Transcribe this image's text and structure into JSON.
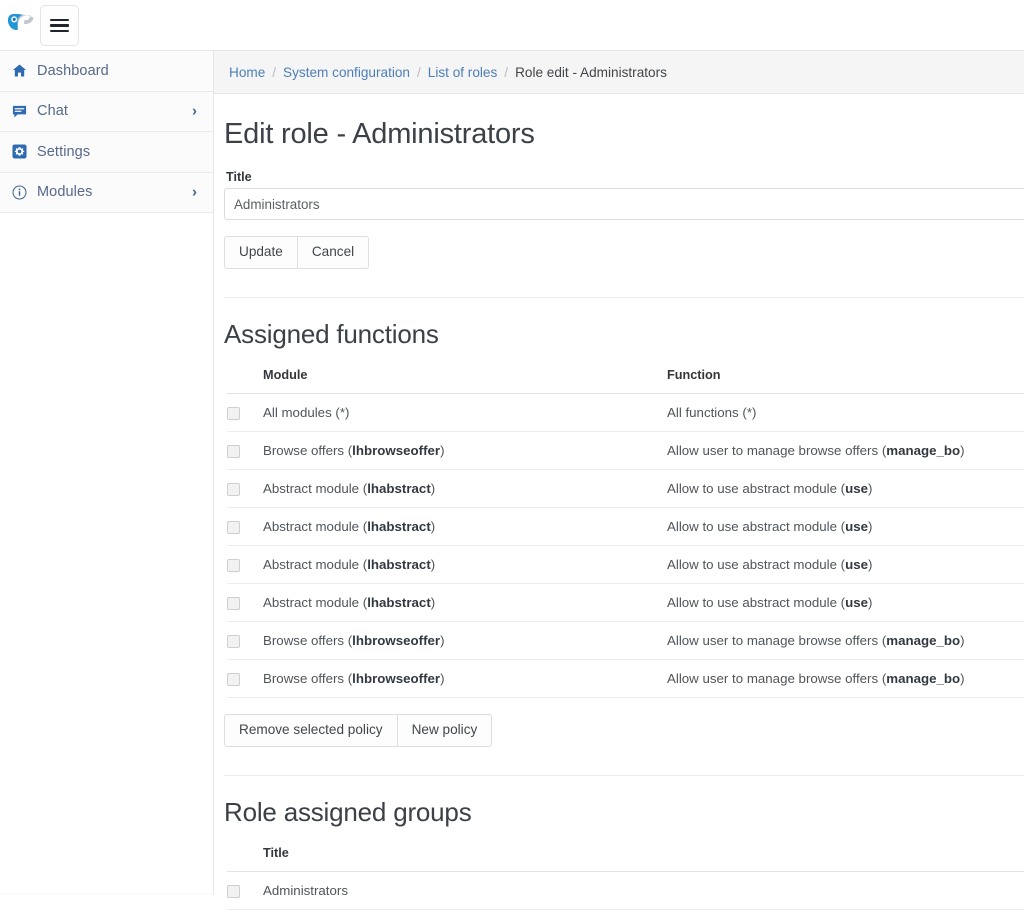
{
  "topbar": {
    "logo_name": "parrot-logo",
    "menu_button_label": "Toggle navigation"
  },
  "sidebar": {
    "items": [
      {
        "label": "Dashboard",
        "icon": "home-icon",
        "chevron": ""
      },
      {
        "label": "Chat",
        "icon": "chat-icon",
        "chevron": "›"
      },
      {
        "label": "Settings",
        "icon": "gear-icon",
        "chevron": ""
      },
      {
        "label": "Modules",
        "icon": "info-icon",
        "chevron": "›"
      }
    ]
  },
  "breadcrumb": {
    "separator": "/",
    "items": [
      {
        "label": "Home",
        "link": true
      },
      {
        "label": "System configuration",
        "link": true
      },
      {
        "label": "List of roles",
        "link": true
      },
      {
        "label": "Role edit - Administrators",
        "link": false
      }
    ]
  },
  "page": {
    "title": "Edit role - Administrators",
    "title_field_label": "Title",
    "title_field_value": "Administrators",
    "title_field_placeholder": "",
    "update_label": "Update",
    "cancel_label": "Cancel"
  },
  "assigned_functions": {
    "heading": "Assigned functions",
    "columns": [
      "Module",
      "Function"
    ],
    "rows": [
      {
        "module_text": "All modules (*)",
        "module_code": "",
        "module_suffix": "",
        "function_text": "All functions (*)",
        "function_code": "",
        "function_suffix": ""
      },
      {
        "module_text": "Browse offers (",
        "module_code": "lhbrowseoffer",
        "module_suffix": ")",
        "function_text": "Allow user to manage browse offers (",
        "function_code": "manage_bo",
        "function_suffix": ")"
      },
      {
        "module_text": "Abstract module (",
        "module_code": "lhabstract",
        "module_suffix": ")",
        "function_text": "Allow to use abstract module (",
        "function_code": "use",
        "function_suffix": ")"
      },
      {
        "module_text": "Abstract module (",
        "module_code": "lhabstract",
        "module_suffix": ")",
        "function_text": "Allow to use abstract module (",
        "function_code": "use",
        "function_suffix": ")"
      },
      {
        "module_text": "Abstract module (",
        "module_code": "lhabstract",
        "module_suffix": ")",
        "function_text": "Allow to use abstract module (",
        "function_code": "use",
        "function_suffix": ")"
      },
      {
        "module_text": "Abstract module (",
        "module_code": "lhabstract",
        "module_suffix": ")",
        "function_text": "Allow to use abstract module (",
        "function_code": "use",
        "function_suffix": ")"
      },
      {
        "module_text": "Browse offers (",
        "module_code": "lhbrowseoffer",
        "module_suffix": ")",
        "function_text": "Allow user to manage browse offers (",
        "function_code": "manage_bo",
        "function_suffix": ")"
      },
      {
        "module_text": "Browse offers (",
        "module_code": "lhbrowseoffer",
        "module_suffix": ")",
        "function_text": "Allow user to manage browse offers (",
        "function_code": "manage_bo",
        "function_suffix": ")"
      }
    ],
    "remove_label": "Remove selected policy",
    "new_label": "New policy"
  },
  "assigned_groups": {
    "heading": "Role assigned groups",
    "columns": [
      "Title"
    ],
    "rows": [
      {
        "title": "Administrators"
      }
    ]
  },
  "colors": {
    "link": "#4c7fb8",
    "nav_text": "#56698a",
    "nav_icon": "#2f6bb0",
    "breadcrumb_bg": "#f5f5f5",
    "sidebar_bg": "#fbfbfb"
  }
}
